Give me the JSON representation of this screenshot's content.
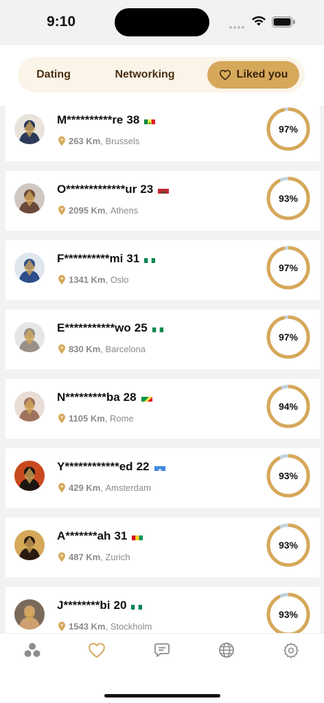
{
  "status_bar": {
    "time": "9:10"
  },
  "tabs": [
    {
      "label": "Dating",
      "active": false
    },
    {
      "label": "Networking",
      "active": false
    },
    {
      "label": "Liked you",
      "active": true
    }
  ],
  "colors": {
    "accent": "#d6a85a",
    "ring_track": "#c3d3dc",
    "segment_bg": "#fbf4e8"
  },
  "matches": [
    {
      "name": "M**********re",
      "age": "38",
      "flag": "senegal",
      "distance": "263 Km",
      "city": "Brussels",
      "percent": "97%",
      "percent_value": 97
    },
    {
      "name": "O*************ur",
      "age": "23",
      "flag": "morocco",
      "distance": "2095 Km",
      "city": "Athens",
      "percent": "93%",
      "percent_value": 93
    },
    {
      "name": "F**********mi",
      "age": "31",
      "flag": "nigeria",
      "distance": "1341 Km",
      "city": "Oslo",
      "percent": "97%",
      "percent_value": 97
    },
    {
      "name": "E***********wo",
      "age": "25",
      "flag": "nigeria",
      "distance": "830 Km",
      "city": "Barcelona",
      "percent": "97%",
      "percent_value": 97
    },
    {
      "name": "N*********ba",
      "age": "28",
      "flag": "congo",
      "distance": "1105 Km",
      "city": "Rome",
      "percent": "94%",
      "percent_value": 94
    },
    {
      "name": "Y************ed",
      "age": "22",
      "flag": "somalia",
      "distance": "429 Km",
      "city": "Amsterdam",
      "percent": "93%",
      "percent_value": 93
    },
    {
      "name": "A*******ah",
      "age": "31",
      "flag": "guinea",
      "distance": "487 Km",
      "city": "Zurich",
      "percent": "93%",
      "percent_value": 93
    },
    {
      "name": "J********bi",
      "age": "20",
      "flag": "nigeria",
      "distance": "1543 Km",
      "city": "Stockholm",
      "percent": "93%",
      "percent_value": 93
    }
  ],
  "bottom_nav": [
    {
      "icon": "discover-icon",
      "active": false
    },
    {
      "icon": "heart-icon",
      "active": true
    },
    {
      "icon": "chat-icon",
      "active": false
    },
    {
      "icon": "globe-icon",
      "active": false
    },
    {
      "icon": "settings-icon",
      "active": false
    }
  ]
}
